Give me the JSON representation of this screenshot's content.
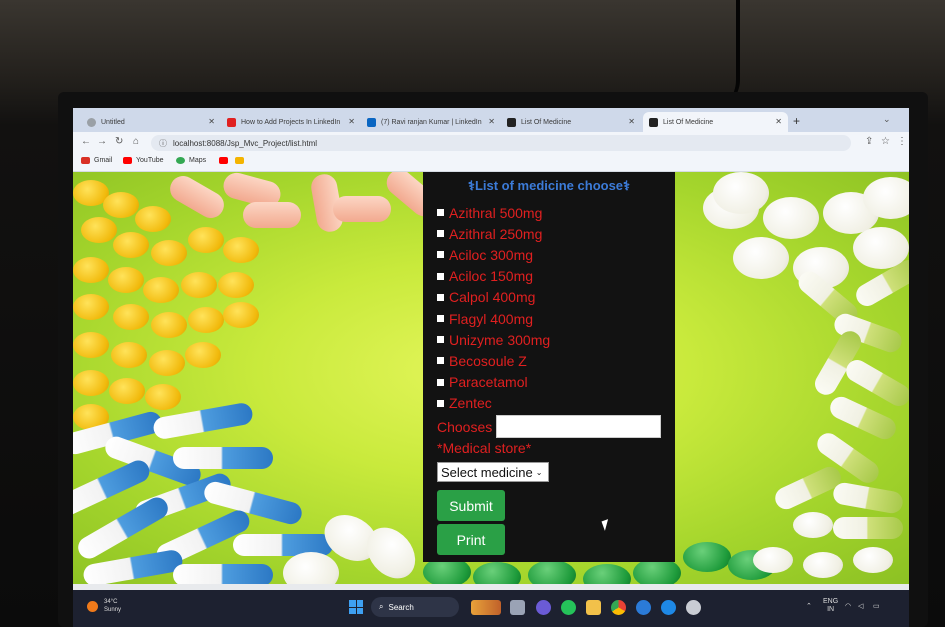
{
  "browser": {
    "tabs": [
      {
        "label": "Untitled",
        "color": "#9aa0a6"
      },
      {
        "label": "How to Add Projects In LinkedIn",
        "color": "#e02020"
      },
      {
        "label": "(7) Ravi ranjan Kumar | LinkedIn",
        "color": "#0a66c2"
      },
      {
        "label": "List Of Medicine",
        "color": "#222"
      },
      {
        "label": "List Of Medicine",
        "color": "#222"
      }
    ],
    "url": "localhost:8088/Jsp_Mvc_Project/list.html",
    "bookmarks": [
      {
        "label": "Gmail",
        "color": "#d93025"
      },
      {
        "label": "YouTube",
        "color": "#ff0000"
      },
      {
        "label": "Maps",
        "color": "#34a853"
      }
    ]
  },
  "form": {
    "title": "List of medicine choose",
    "medicines": [
      "Azithral 500mg",
      "Azithral 250mg",
      "Aciloc 300mg",
      "Aciloc 150mg",
      "Calpol 400mg",
      "Flagyl 400mg",
      "Unizyme 300mg",
      "Becosoule Z",
      "Paracetamol",
      "Zentec"
    ],
    "chooses_label": "Chooses",
    "store_label": "*Medical store*",
    "select_value": "Select medicine",
    "submit_label": "Submit",
    "print_label": "Print"
  },
  "taskbar": {
    "temp": "34°C",
    "weather": "Sunny",
    "search": "Search",
    "lang_top": "ENG",
    "lang_bottom": "IN"
  }
}
